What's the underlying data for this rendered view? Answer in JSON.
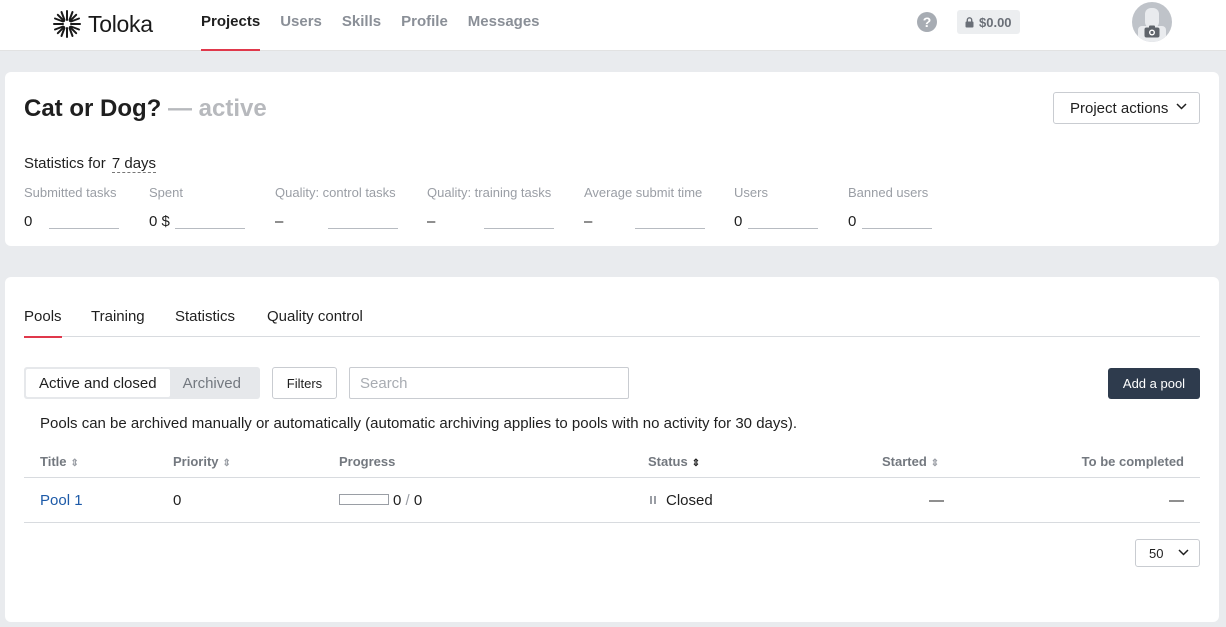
{
  "brand": {
    "name": "Toloka"
  },
  "nav": [
    {
      "label": "Projects",
      "active": true
    },
    {
      "label": "Users",
      "active": false
    },
    {
      "label": "Skills",
      "active": false
    },
    {
      "label": "Profile",
      "active": false
    },
    {
      "label": "Messages",
      "active": false
    }
  ],
  "header": {
    "help_glyph": "?",
    "balance": "$0.00"
  },
  "project": {
    "title": "Cat or Dog?",
    "status": "— active",
    "actions_label": "Project actions",
    "stats_prefix": "Statistics for",
    "stats_period": "7 days",
    "stats": [
      {
        "label": "Submitted tasks",
        "value": "0"
      },
      {
        "label": "Spent",
        "value": "0 $"
      },
      {
        "label": "Quality: control tasks",
        "value": "–"
      },
      {
        "label": "Quality: training tasks",
        "value": "–"
      },
      {
        "label": "Average submit time",
        "value": "–"
      },
      {
        "label": "Users",
        "value": "0"
      },
      {
        "label": "Banned users",
        "value": "0"
      }
    ]
  },
  "tabs": [
    {
      "label": "Pools",
      "active": true
    },
    {
      "label": "Training",
      "active": false
    },
    {
      "label": "Statistics",
      "active": false
    },
    {
      "label": "Quality control",
      "active": false
    }
  ],
  "pools": {
    "segments": [
      {
        "label": "Active and closed",
        "active": true
      },
      {
        "label": "Archived",
        "active": false
      }
    ],
    "filters_label": "Filters",
    "search_placeholder": "Search",
    "add_label": "Add a pool",
    "archive_note": "Pools can be archived manually or automatically (automatic archiving applies to pools with no activity for 30 days).",
    "columns": {
      "title": "Title",
      "priority": "Priority",
      "progress": "Progress",
      "status": "Status",
      "started": "Started",
      "to_complete": "To be completed"
    },
    "rows": [
      {
        "title": "Pool 1",
        "priority": "0",
        "progress_done": "0",
        "progress_slash": "/",
        "progress_total": "0",
        "progress_fraction": 0,
        "status": "Closed",
        "started": "—",
        "to_complete": "—"
      }
    ],
    "per_page": "50"
  },
  "colors": {
    "accent": "#e0384b",
    "primary_button": "#2e3b4d",
    "link": "#1d5aa8"
  }
}
